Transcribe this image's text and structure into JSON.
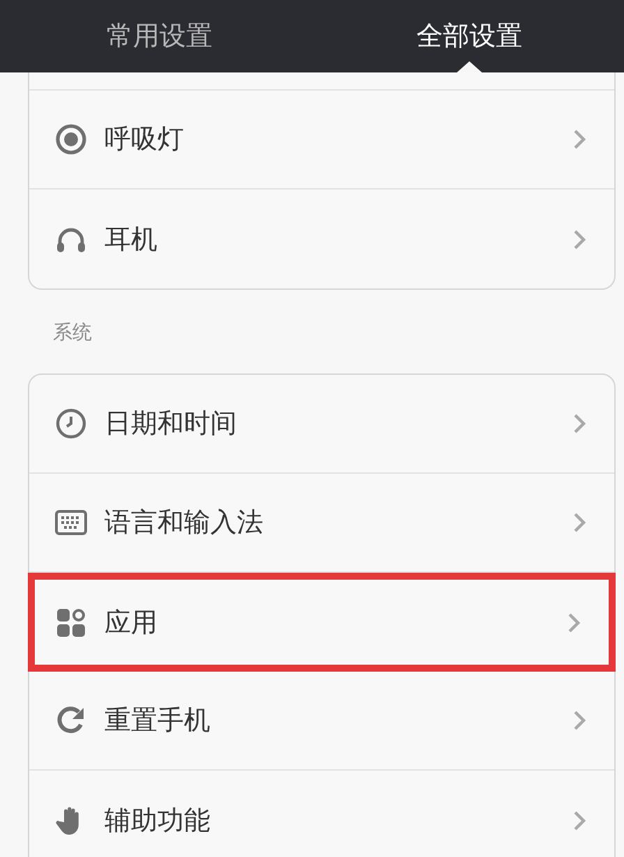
{
  "tabs": [
    {
      "label": "常用设置",
      "selected": false
    },
    {
      "label": "全部设置",
      "selected": true
    }
  ],
  "groups": [
    {
      "items": [
        {
          "kind": "light",
          "label": "呼吸灯",
          "highlighted": false
        },
        {
          "kind": "headphones",
          "label": "耳机",
          "highlighted": false
        }
      ]
    },
    {
      "title": "系统",
      "items": [
        {
          "kind": "clock",
          "label": "日期和时间",
          "highlighted": false
        },
        {
          "kind": "keyboard",
          "label": "语言和输入法",
          "highlighted": false
        },
        {
          "kind": "apps",
          "label": "应用",
          "highlighted": true
        },
        {
          "kind": "reset",
          "label": "重置手机",
          "highlighted": false
        },
        {
          "kind": "hand",
          "label": "辅助功能",
          "highlighted": false
        }
      ]
    }
  ]
}
